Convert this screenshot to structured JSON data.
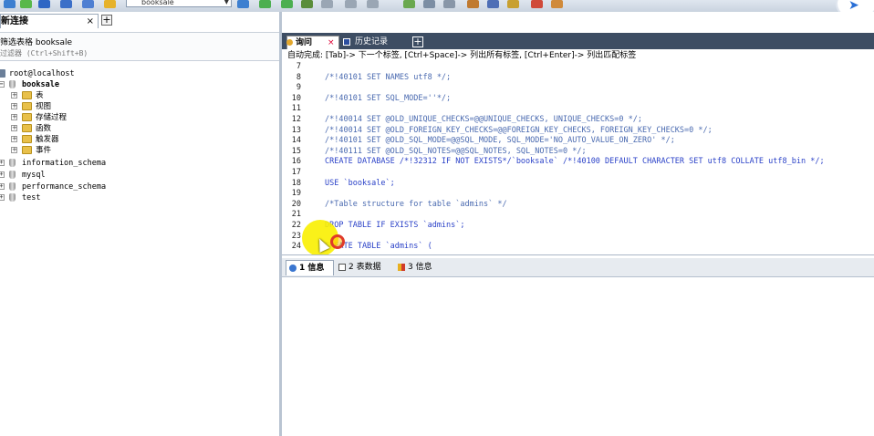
{
  "toolbar": {
    "db_selector_value": "booksale"
  },
  "connections": {
    "tab_label": "新连接",
    "close_symbol": "×",
    "add_symbol": "+"
  },
  "filter": {
    "title": "筛选表格 booksale",
    "placeholder": "过滤器 (Ctrl+Shift+B)"
  },
  "tree": {
    "server": "root@localhost",
    "active_db": "booksale",
    "children": [
      "表",
      "视图",
      "存储过程",
      "函数",
      "触发器",
      "事件"
    ],
    "other_dbs": [
      "information_schema",
      "mysql",
      "performance_schema",
      "test"
    ]
  },
  "query_tabs": {
    "query": "询问",
    "close_symbol": "×",
    "history": "历史记录",
    "add_symbol": "+"
  },
  "autocomplete_hint": "自动完成: [Tab]-> 下一个标签, [Ctrl+Space]-> 列出所有标签, [Ctrl+Enter]-> 列出匹配标签",
  "editor": {
    "lines": [
      {
        "n": "7",
        "text": ""
      },
      {
        "n": "8",
        "text": "/*!40101 SET NAMES utf8 */;"
      },
      {
        "n": "9",
        "text": ""
      },
      {
        "n": "10",
        "text": "/*!40101 SET SQL_MODE=''*/;"
      },
      {
        "n": "11",
        "text": ""
      },
      {
        "n": "12",
        "text": "/*!40014 SET @OLD_UNIQUE_CHECKS=@@UNIQUE_CHECKS, UNIQUE_CHECKS=0 */;"
      },
      {
        "n": "13",
        "text": "/*!40014 SET @OLD_FOREIGN_KEY_CHECKS=@@FOREIGN_KEY_CHECKS, FOREIGN_KEY_CHECKS=0 */;"
      },
      {
        "n": "14",
        "text": "/*!40101 SET @OLD_SQL_MODE=@@SQL_MODE, SQL_MODE='NO_AUTO_VALUE_ON_ZERO' */;"
      },
      {
        "n": "15",
        "text": "/*!40111 SET @OLD_SQL_NOTES=@@SQL_NOTES, SQL_NOTES=0 */;"
      },
      {
        "n": "16",
        "text": "CREATE DATABASE /*!32312 IF NOT EXISTS*/`booksale` /*!40100 DEFAULT CHARACTER SET utf8 COLLATE utf8_bin */;"
      },
      {
        "n": "17",
        "text": ""
      },
      {
        "n": "18",
        "text": "USE `booksale`;"
      },
      {
        "n": "19",
        "text": ""
      },
      {
        "n": "20",
        "text": "/*Table structure for table `admins` */"
      },
      {
        "n": "21",
        "text": ""
      },
      {
        "n": "22",
        "text": "DROP TABLE IF EXISTS `admins`;"
      },
      {
        "n": "23",
        "text": ""
      },
      {
        "n": "24",
        "text": "CREATE TABLE `admins` ("
      }
    ]
  },
  "result_tabs": {
    "info": "1 信息",
    "table_data": "2 表数据",
    "info2": "3 信息"
  },
  "colors": {
    "tab_bar": "#3d4d63",
    "keyword": "#2b42c8",
    "comment": "#4a6ab0",
    "cursor_highlight": "#f5ee00"
  }
}
